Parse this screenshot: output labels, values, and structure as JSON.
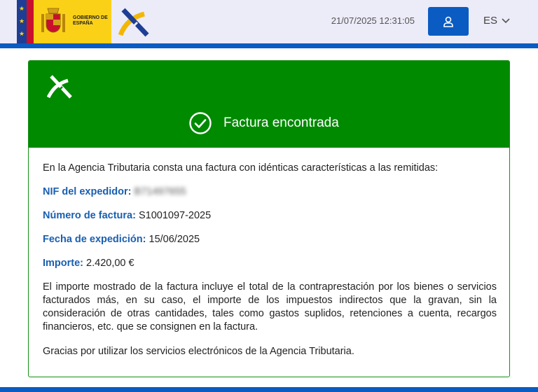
{
  "header": {
    "gov_text": "GOBIERNO DE ESPAÑA",
    "datetime": "21/07/2025 12:31:05",
    "lang": "ES",
    "user_icon": "user-icon",
    "colors": {
      "top_bg": "#ecebf8",
      "blue": "#0a5cc2",
      "yellow": "#fbd118"
    }
  },
  "card": {
    "title": "Factura encontrada",
    "intro": "En la Agencia Tributaria consta una factura con idénticas características a las remitidas:",
    "fields": [
      {
        "label": "NIF del expedidor:",
        "value": "B71497655"
      },
      {
        "label": "Número de factura:",
        "value": "S1001097-2025"
      },
      {
        "label": "Fecha de expedición:",
        "value": "15/06/2025"
      },
      {
        "label": "Importe:",
        "value": "2.420,00 €"
      }
    ],
    "disclaimer": "El importe mostrado de la factura incluye el total de la contraprestación por los bienes o servicios facturados más, en su caso, el importe de los impuestos indirectos que la gravan, sin la consideración de otras cantidades, tales como gastos suplidos, retenciones a cuenta, recargos financieros, etc. que se consignen en la factura.",
    "thanks": "Gracias por utilizar los servicios electrónicos de la Agencia Tributaria.",
    "colors": {
      "header_green": "#008a00",
      "label_blue": "#1a5fb0"
    }
  }
}
